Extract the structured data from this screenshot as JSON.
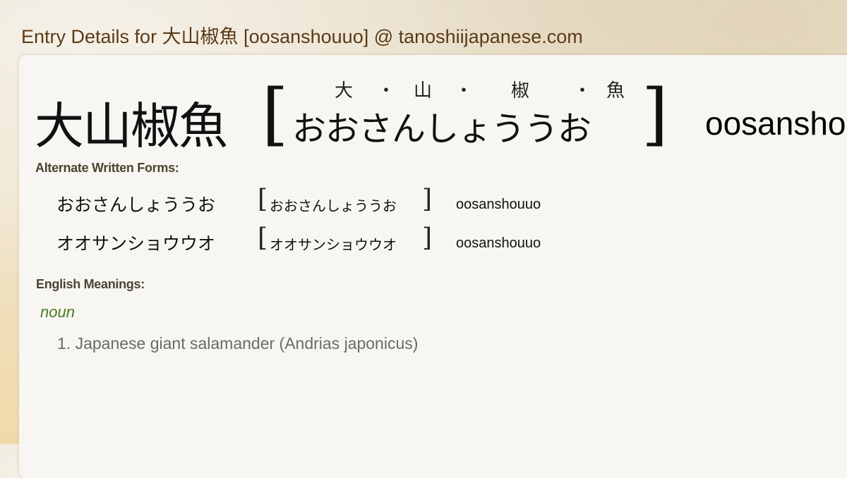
{
  "site_title": "Entry Details for 大山椒魚 [oosanshouuo] @ tanoshiijapanese.com",
  "headword": {
    "kanji": "大山椒魚",
    "bracket_open": "[",
    "bracket_close": "]",
    "furigana": [
      "大",
      "・",
      "山",
      "・",
      "椒",
      "・",
      "魚"
    ],
    "reading": "おおさんしょううお",
    "romaji": "oosanshouuo"
  },
  "alternate_forms": {
    "label": "Alternate Written Forms:",
    "items": [
      {
        "written": "おおさんしょううお",
        "reading": "おおさんしょううお",
        "romaji": "oosanshouuo"
      },
      {
        "written": "オオサンショウウオ",
        "reading": "オオサンショウウオ",
        "romaji": "oosanshouuo"
      }
    ]
  },
  "meanings": {
    "label": "English Meanings:",
    "part_of_speech": "noun",
    "items": [
      "1. Japanese giant salamander (Andrias japonicus)"
    ]
  },
  "colors": {
    "title": "#5b3a17",
    "part_of_speech": "#4d7a1e",
    "meaning_text": "#6a6a6a",
    "section_label": "#4a4532"
  }
}
